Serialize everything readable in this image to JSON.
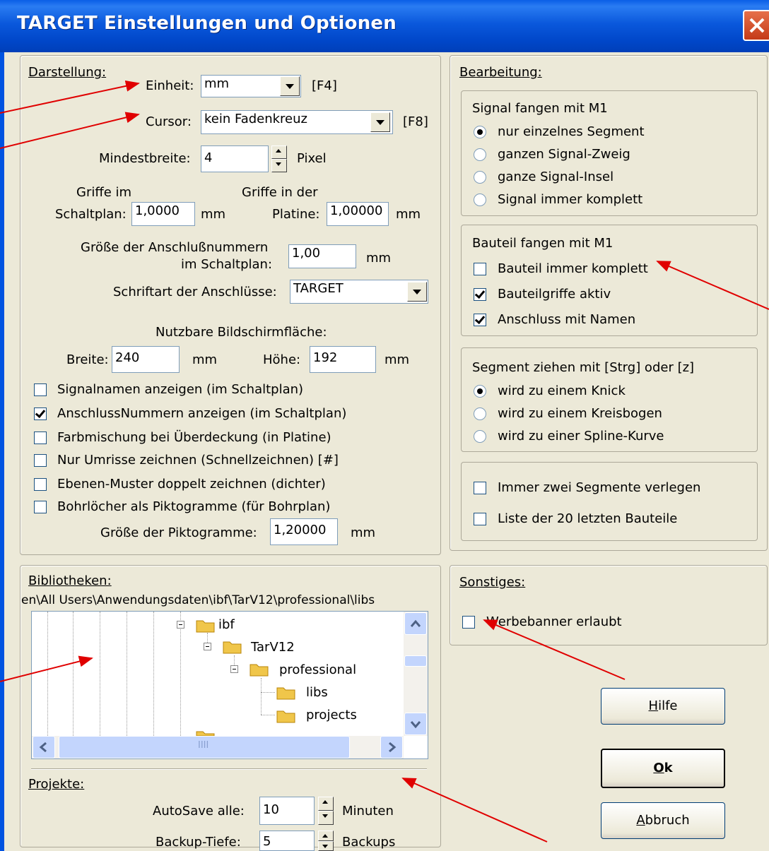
{
  "window": {
    "title": "TARGET Einstellungen und Optionen"
  },
  "darstellung": {
    "heading": "Darstellung:",
    "einheit_label": "Einheit:",
    "einheit_value": "mm",
    "einheit_key": "[F4]",
    "cursor_label": "Cursor:",
    "cursor_value": "kein Fadenkreuz",
    "cursor_key": "[F8]",
    "mindestbreite_label": "Mindestbreite:",
    "mindestbreite_value": "4",
    "mindestbreite_unit": "Pixel",
    "griffe_schaltplan_l1": "Griffe im",
    "griffe_schaltplan_l2": "Schaltplan:",
    "griffe_schaltplan_value": "1,0000",
    "griffe_schaltplan_unit": "mm",
    "griffe_platine_l1": "Griffe in der",
    "griffe_platine_l2": "Platine:",
    "griffe_platine_value": "1,00000",
    "griffe_platine_unit": "mm",
    "anschluss_groesse_l1": "Größe der Anschlußnummern",
    "anschluss_groesse_l2": "im Schaltplan:",
    "anschluss_groesse_value": "1,00",
    "anschluss_groesse_unit": "mm",
    "schriftart_label": "Schriftart der Anschlüsse:",
    "schriftart_value": "TARGET",
    "bildschirm_heading": "Nutzbare Bildschirmfläche:",
    "breite_label": "Breite:",
    "breite_value": "240",
    "breite_unit": "mm",
    "hoehe_label": "Höhe:",
    "hoehe_value": "192",
    "hoehe_unit": "mm",
    "checkboxes": [
      {
        "label": "Signalnamen anzeigen (im Schaltplan)",
        "checked": false
      },
      {
        "label": "AnschlussNummern anzeigen (im Schaltplan)",
        "checked": true
      },
      {
        "label": "Farbmischung bei Überdeckung (in Platine)",
        "checked": false
      },
      {
        "label": "Nur Umrisse zeichnen (Schnellzeichnen)  [#]",
        "checked": false
      },
      {
        "label": "Ebenen-Muster doppelt zeichnen (dichter)",
        "checked": false
      },
      {
        "label": "Bohrlöcher als Piktogramme (für Bohrplan)",
        "checked": false
      }
    ],
    "piktogramme_label": "Größe der Piktogramme:",
    "piktogramme_value": "1,20000",
    "piktogramme_unit": "mm"
  },
  "bearbeitung": {
    "heading": "Bearbeitung:",
    "signal_heading": "Signal fangen mit M1",
    "signal_options": [
      {
        "label": "nur einzelnes Segment",
        "checked": true
      },
      {
        "label": "ganzen Signal-Zweig",
        "checked": false
      },
      {
        "label": "ganze Signal-Insel",
        "checked": false
      },
      {
        "label": "Signal immer komplett",
        "checked": false
      }
    ],
    "bauteil_heading": "Bauteil fangen mit M1",
    "bauteil_options": [
      {
        "label": "Bauteil immer komplett",
        "checked": false
      },
      {
        "label": "Bauteilgriffe aktiv",
        "checked": true
      },
      {
        "label": "Anschluss mit Namen",
        "checked": true
      }
    ],
    "segment_heading": "Segment ziehen mit [Strg] oder [z]",
    "segment_options": [
      {
        "label": "wird zu einem Knick",
        "checked": true
      },
      {
        "label": "wird zu einem Kreisbogen",
        "checked": false
      },
      {
        "label": "wird zu einer Spline-Kurve",
        "checked": false
      }
    ],
    "misc_options": [
      {
        "label": "Immer zwei Segmente verlegen",
        "checked": false
      },
      {
        "label": "Liste der 20 letzten Bauteile",
        "checked": false
      }
    ]
  },
  "bibliotheken": {
    "heading": "Bibliotheken:",
    "path": "en\\All Users\\Anwendungsdaten\\ibf\\TarV12\\professional\\libs",
    "tree": [
      "ibf",
      "TarV12",
      "professional",
      "libs",
      "projects"
    ],
    "hscroll_grip": "IIII"
  },
  "projekte": {
    "heading": "Projekte:",
    "autosave_label": "AutoSave alle:",
    "autosave_value": "10",
    "autosave_unit": "Minuten",
    "backup_label": "Backup-Tiefe:",
    "backup_value": "5",
    "backup_unit": "Backups"
  },
  "sonstiges": {
    "heading": "Sonstiges:",
    "werbebanner_label": "Werbebanner erlaubt",
    "werbebanner_checked": false
  },
  "buttons": {
    "hilfe_pre": "",
    "hilfe_mn": "H",
    "hilfe_post": "ilfe",
    "ok_pre": "",
    "ok_mn": "O",
    "ok_post": "k",
    "abbruch_pre": "",
    "abbruch_mn": "A",
    "abbruch_post": "bbruch"
  },
  "colors": {
    "annotation_arrow": "#e00000",
    "titlebar": "#0054e3"
  }
}
